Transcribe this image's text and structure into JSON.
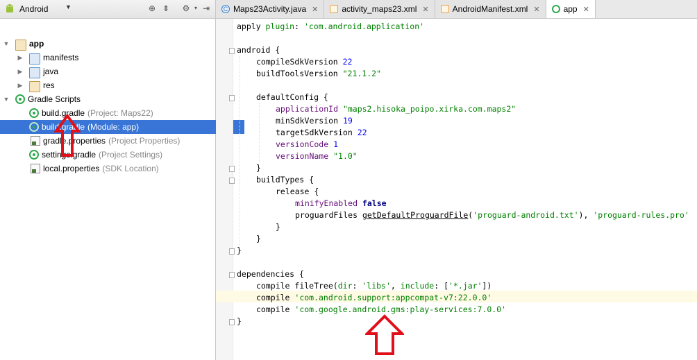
{
  "project_pane": {
    "view": "Android",
    "tree": [
      {
        "name": "app",
        "hint": "",
        "expanded": true
      },
      {
        "name": "manifests",
        "hint": ""
      },
      {
        "name": "java",
        "hint": ""
      },
      {
        "name": "res",
        "hint": ""
      },
      {
        "name": "Gradle Scripts",
        "hint": "",
        "expanded": true
      },
      {
        "name": "build.gradle",
        "hint": "(Project: Maps22)"
      },
      {
        "name": "build.gradle",
        "hint": "(Module: app)"
      },
      {
        "name": "gradle.properties",
        "hint": "(Project Properties)"
      },
      {
        "name": "settings.gradle",
        "hint": "(Project Settings)"
      },
      {
        "name": "local.properties",
        "hint": "(SDK Location)"
      }
    ]
  },
  "tabs": [
    {
      "label": "Maps23Activity.java",
      "icon": "java-class-icon"
    },
    {
      "label": "activity_maps23.xml",
      "icon": "xml-file-icon"
    },
    {
      "label": "AndroidManifest.xml",
      "icon": "manifest-file-icon"
    },
    {
      "label": "app",
      "icon": "gradle-icon",
      "active": true
    }
  ],
  "code": {
    "l1a": "apply ",
    "l1b": "plugin",
    "l1c": ": ",
    "l1d": "'com.android.application'",
    "android": "android {",
    "compileSdk": "compileSdkVersion ",
    "compileSdkV": "22",
    "buildTools": "buildToolsVersion ",
    "buildToolsV": "\"21.1.2\"",
    "defaultConfig": "defaultConfig {",
    "appId": "applicationId ",
    "appIdV": "\"maps2.hisoka_poipo.xirka.com.maps2\"",
    "minSdk": "minSdkVersion ",
    "minSdkV": "19",
    "targetSdk": "targetSdkVersion ",
    "targetSdkV": "22",
    "versionCode": "versionCode ",
    "versionCodeV": "1",
    "versionName": "versionName ",
    "versionNameV": "\"1.0\"",
    "close": "}",
    "buildTypes": "buildTypes {",
    "release": "release {",
    "minify": "minifyEnabled ",
    "minifyV": "false",
    "proguard": "proguardFiles ",
    "proguardFn": "getDefaultProguardFile",
    "proguardA": "(",
    "proguardS1": "'proguard-android.txt'",
    "proguardSep": "), ",
    "proguardS2": "'proguard-rules.pro'",
    "deps": "dependencies {",
    "c1a": "compile ",
    "c1b": "fileTree",
    "c1c": "(",
    "c1d": "dir",
    "c1e": ": ",
    "c1f": "'libs'",
    "c1g": ", ",
    "c1h": "include",
    "c1i": ": [",
    "c1j": "'*.jar'",
    "c1k": "])",
    "c2a": "compile ",
    "c2b": "'com.android.support:appcompat-v7:22.0.0'",
    "c3a": "compile ",
    "c3b": "'com.google.android.gms:play-services:7.0.0'"
  },
  "colors": {
    "selection": "#3875d7",
    "annotation_arrow": "#e0101a",
    "string": "#008000",
    "number": "#0000ff"
  }
}
